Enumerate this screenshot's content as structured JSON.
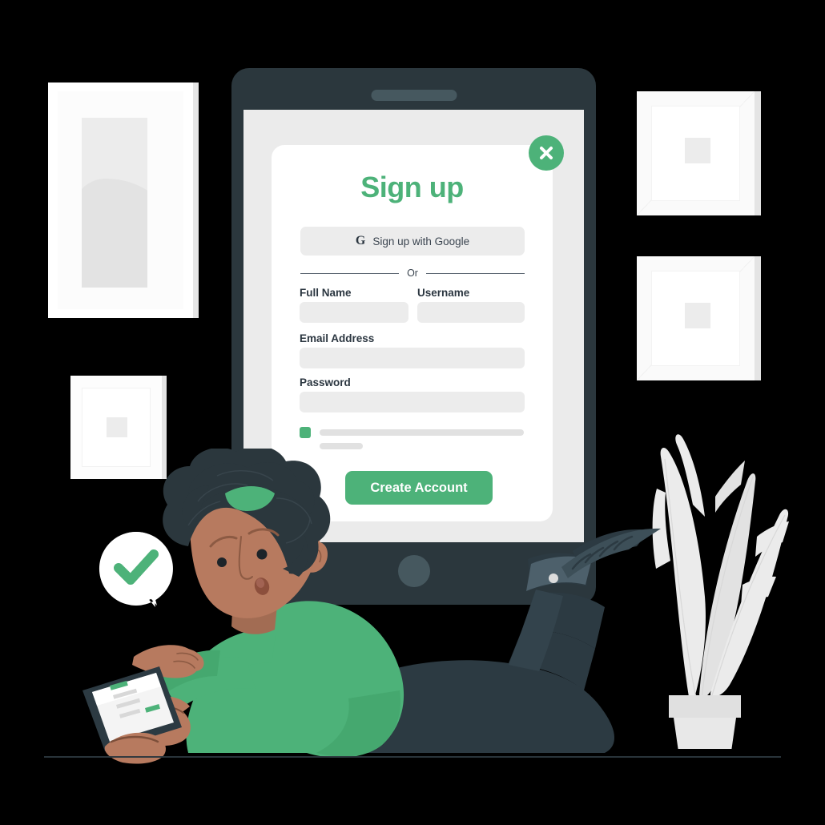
{
  "scene": {
    "background_color": "#000000",
    "accent_green": "#4db279",
    "dark_navy": "#2b373d",
    "screen_gray": "#ebebeb",
    "field_gray": "#ececec"
  },
  "device": {
    "name": "tablet",
    "speaker_label": "speaker-bar",
    "home_button_label": "home-button"
  },
  "signup_card": {
    "title": "Sign up",
    "close_label": "×",
    "google_button": {
      "icon": "G",
      "label": "Sign up with Google"
    },
    "divider_label": "Or",
    "fields": [
      {
        "id": "fullname",
        "label": "Full Name",
        "value": "",
        "placeholder": ""
      },
      {
        "id": "username",
        "label": "Username",
        "value": "",
        "placeholder": ""
      },
      {
        "id": "email",
        "label": "Email Address",
        "value": "",
        "placeholder": ""
      },
      {
        "id": "password",
        "label": "Password",
        "value": "",
        "placeholder": ""
      }
    ],
    "terms": {
      "checkbox_checked": true,
      "line1_text": "",
      "line2_text": ""
    },
    "submit_label": "Create Account"
  },
  "decor": {
    "frames": [
      {
        "name": "tall-portrait-frame"
      },
      {
        "name": "small-square-frame"
      },
      {
        "name": "right-square-frame-top"
      },
      {
        "name": "right-square-frame-bottom"
      }
    ],
    "plant": "potted-plant",
    "check_bubble": "success-check-bubble",
    "ground": "floor-line"
  },
  "character": {
    "name": "person-lying-with-tablet",
    "sweater_color": "#4db279",
    "skin_color": "#b77a5f",
    "hair_color": "#2b373d",
    "pants_color": "#2c3a42",
    "hairband_color": "#4db279"
  }
}
